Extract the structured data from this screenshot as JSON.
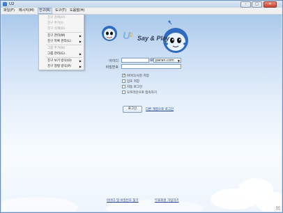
{
  "window": {
    "title": "U2"
  },
  "menu": [
    "파일(F)",
    "메시지(M)",
    "친구(R)",
    "도구(T)",
    "도움말(H)"
  ],
  "dropdown": {
    "items": [
      {
        "label": "친구 검색(H)",
        "disabled": true,
        "submenu": false
      },
      {
        "label": "친구 추가(I)",
        "disabled": true,
        "submenu": false
      },
      {
        "label": "친구 삭제(D)",
        "disabled": true,
        "submenu": false
      },
      {
        "label": "친구 관리(M)",
        "disabled": false,
        "submenu": true
      },
      {
        "label": "친구 목록 관리(L)",
        "disabled": false,
        "submenu": true
      },
      {
        "label": "그룹 추가(N)",
        "disabled": true,
        "submenu": false
      },
      {
        "label": "그룹 관리(G)",
        "disabled": false,
        "submenu": true
      },
      {
        "label": "친구 보기 방식(O)",
        "disabled": false,
        "submenu": true
      },
      {
        "label": "친구 정렬 방식(P)",
        "disabled": false,
        "submenu": true
      }
    ]
  },
  "logo": {
    "text": "Say & Play"
  },
  "login": {
    "id_label": "아이디",
    "at": "@",
    "domain_value": "paran.com",
    "password_label": "비밀번호",
    "checkboxes": [
      {
        "label": "아이디/사진 저장",
        "checked": true
      },
      {
        "label": "암호 저장",
        "checked": false
      },
      {
        "label": "자동 로그인",
        "checked": false
      },
      {
        "label": "오프라인으로 접속하기",
        "checked": false
      }
    ],
    "login_button": "로그인",
    "other_account_link": "다른 계정으로 로그인"
  },
  "footer": {
    "find_link": "아이디 및 비밀번호 찾기",
    "signup_link": "무료회원 가입하기"
  },
  "colors": {
    "accent": "#3a7fd0",
    "link": "#1c3e8c"
  }
}
